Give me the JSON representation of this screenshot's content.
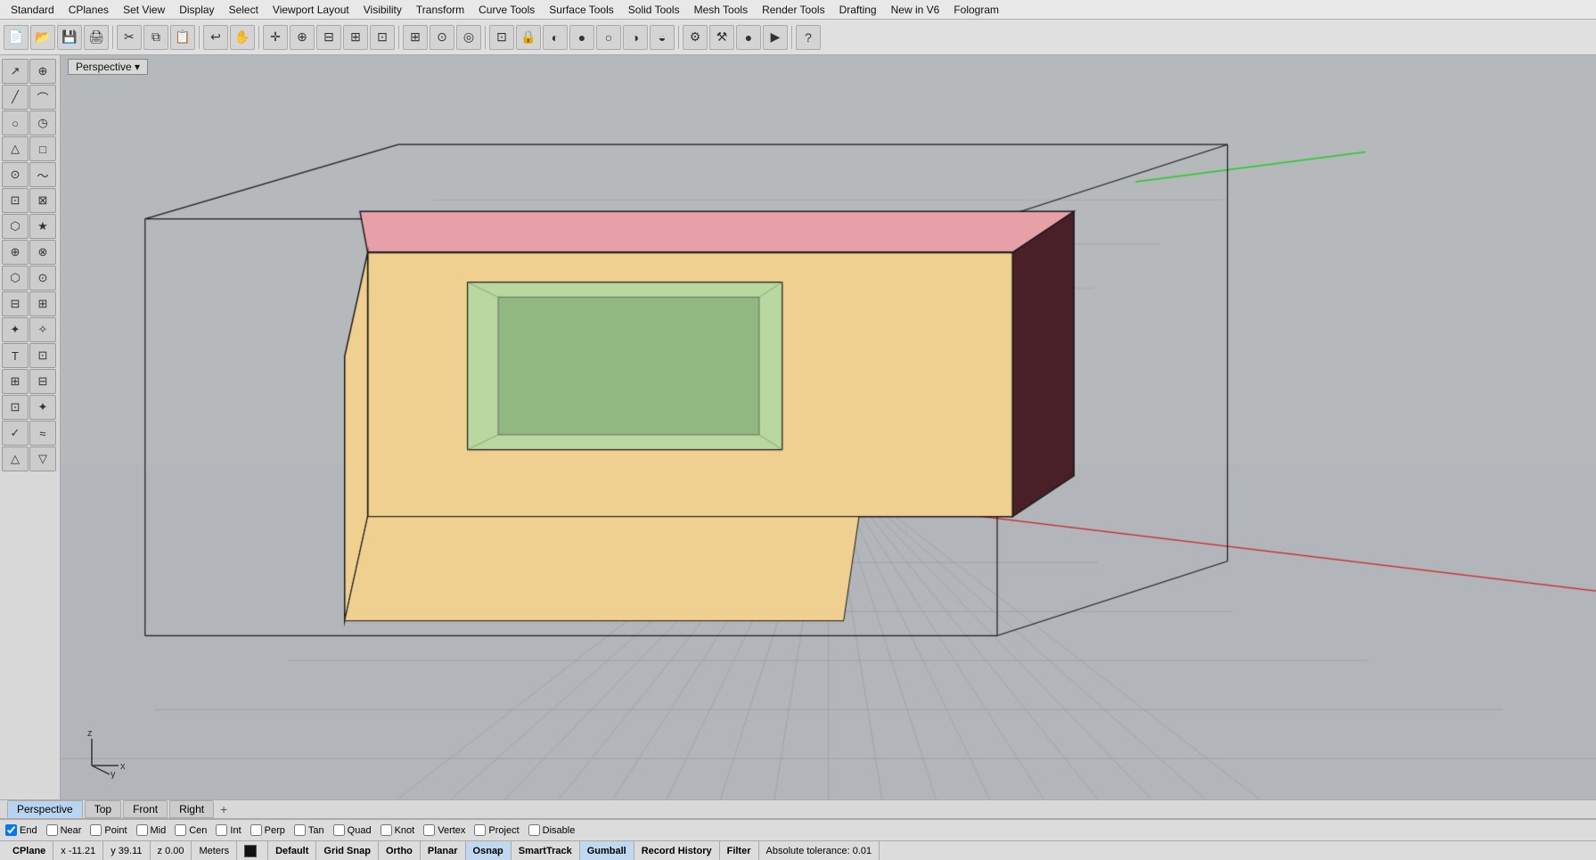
{
  "menubar": {
    "items": [
      "Standard",
      "CPlanes",
      "Set View",
      "Display",
      "Select",
      "Viewport Layout",
      "Visibility",
      "Transform",
      "Curve Tools",
      "Surface Tools",
      "Solid Tools",
      "Mesh Tools",
      "Render Tools",
      "Drafting",
      "New in V6",
      "Fologram"
    ]
  },
  "toolbar": {
    "buttons": [
      {
        "name": "new",
        "icon": "📄"
      },
      {
        "name": "open",
        "icon": "📂"
      },
      {
        "name": "save",
        "icon": "💾"
      },
      {
        "name": "print",
        "icon": "🖨"
      },
      {
        "name": "cut2",
        "icon": "✂"
      },
      {
        "name": "copy",
        "icon": "⧉"
      },
      {
        "name": "paste",
        "icon": "📋"
      },
      {
        "name": "undo",
        "icon": "↩"
      },
      {
        "name": "pan",
        "icon": "✋"
      },
      {
        "name": "move",
        "icon": "✛"
      },
      {
        "name": "zoom-in",
        "icon": "🔍"
      },
      {
        "name": "zoom-ext",
        "icon": "⊕"
      },
      {
        "name": "zoom-win",
        "icon": "⊞"
      },
      {
        "name": "zoom-all",
        "icon": "⊟"
      },
      {
        "name": "grid",
        "icon": "⊞"
      },
      {
        "name": "snap1",
        "icon": "⊙"
      },
      {
        "name": "obj-snap",
        "icon": "◎"
      },
      {
        "name": "planar",
        "icon": "⊡"
      },
      {
        "name": "lock",
        "icon": "🔒"
      },
      {
        "name": "material",
        "icon": "◐"
      },
      {
        "name": "render-sphere",
        "icon": "●"
      },
      {
        "name": "shaded",
        "icon": "○"
      },
      {
        "name": "pts",
        "icon": "·"
      },
      {
        "name": "tools1",
        "icon": "⚙"
      },
      {
        "name": "tools2",
        "icon": "⚒"
      },
      {
        "name": "record",
        "icon": "●"
      },
      {
        "name": "play",
        "icon": "▶"
      },
      {
        "name": "help",
        "icon": "?"
      }
    ]
  },
  "left_tools": [
    [
      {
        "icon": "↗",
        "name": "select-arrow"
      },
      {
        "icon": "⊕",
        "name": "select-point"
      }
    ],
    [
      {
        "icon": "╱",
        "name": "line"
      },
      {
        "icon": "⌒",
        "name": "polyline"
      }
    ],
    [
      {
        "icon": "○",
        "name": "circle"
      },
      {
        "icon": "◷",
        "name": "arc"
      }
    ],
    [
      {
        "icon": "△",
        "name": "triangle"
      },
      {
        "icon": "□",
        "name": "rectangle"
      }
    ],
    [
      {
        "icon": "⊙",
        "name": "curve-blend"
      },
      {
        "icon": "〜",
        "name": "freeform-curve"
      }
    ],
    [
      {
        "icon": "⊡",
        "name": "surface-from-curve"
      },
      {
        "icon": "⊠",
        "name": "loft"
      }
    ],
    [
      {
        "icon": "⬡",
        "name": "mesh"
      },
      {
        "icon": "★",
        "name": "special"
      }
    ],
    [
      {
        "icon": "⊕",
        "name": "transform"
      },
      {
        "icon": "⊗",
        "name": "boolean"
      }
    ],
    [
      {
        "icon": "⬡",
        "name": "solid-box"
      },
      {
        "icon": "⊙",
        "name": "sphere-tool"
      }
    ],
    [
      {
        "icon": "⊟",
        "name": "cylinder"
      },
      {
        "icon": "⊞",
        "name": "cone"
      }
    ],
    [
      {
        "icon": "✦",
        "name": "subd"
      },
      {
        "icon": "✧",
        "name": "subd2"
      }
    ],
    [
      {
        "icon": "T",
        "name": "text"
      },
      {
        "icon": "⊡",
        "name": "dimension"
      }
    ],
    [
      {
        "icon": "⊞",
        "name": "group"
      },
      {
        "icon": "⊟",
        "name": "block"
      }
    ],
    [
      {
        "icon": "⊡",
        "name": "history"
      },
      {
        "icon": "✦",
        "name": "gumball"
      }
    ],
    [
      {
        "icon": "✓",
        "name": "check"
      },
      {
        "icon": "≈",
        "name": "analyze"
      }
    ],
    [
      {
        "icon": "△",
        "name": "taper"
      },
      {
        "icon": "▽",
        "name": "taper2"
      }
    ]
  ],
  "viewport": {
    "label": "Perspective",
    "dropdown_icon": "▾",
    "axes": {
      "x_label": "x",
      "y_label": "y",
      "z_label": "z"
    }
  },
  "viewport_tabs": {
    "tabs": [
      "Perspective",
      "Top",
      "Front",
      "Right"
    ],
    "active": "Perspective",
    "add_icon": "+"
  },
  "snap_bar": {
    "items": [
      {
        "label": "End",
        "checked": true
      },
      {
        "label": "Near",
        "checked": false
      },
      {
        "label": "Point",
        "checked": false
      },
      {
        "label": "Mid",
        "checked": false
      },
      {
        "label": "Cen",
        "checked": false
      },
      {
        "label": "Int",
        "checked": false
      },
      {
        "label": "Perp",
        "checked": false
      },
      {
        "label": "Tan",
        "checked": false
      },
      {
        "label": "Quad",
        "checked": false
      },
      {
        "label": "Knot",
        "checked": false
      },
      {
        "label": "Vertex",
        "checked": false
      },
      {
        "label": "Project",
        "checked": false
      },
      {
        "label": "Disable",
        "checked": false
      }
    ]
  },
  "statusbar": {
    "cplane": "CPlane",
    "x": "x -11.21",
    "y": "y 39.11",
    "z": "z 0.00",
    "units": "Meters",
    "layer_color": "#111111",
    "layer": "Default",
    "grid_snap": "Grid Snap",
    "ortho": "Ortho",
    "planar": "Planar",
    "osnap": "Osnap",
    "smarttrack": "SmartTrack",
    "gumball": "Gumball",
    "record_history": "Record History",
    "filter": "Filter",
    "tolerance": "Absolute tolerance: 0.01"
  },
  "viewport_labels": {
    "top": "Top",
    "front": "Front",
    "right": "Right",
    "perspective": "Perspective"
  },
  "colors": {
    "bg_viewport": "#b0b4b8",
    "grid_line": "#a0a0a0",
    "box_top": "#e8a0a8",
    "box_front": "#f0d090",
    "box_right": "#5a2830",
    "box_green_inset": "#b8d8a0",
    "box_green_dark": "#90b880",
    "box_outline": "#1a1a1a",
    "grid_accent": "#888888",
    "axis_green": "#00cc00",
    "axis_red": "#cc0000"
  }
}
